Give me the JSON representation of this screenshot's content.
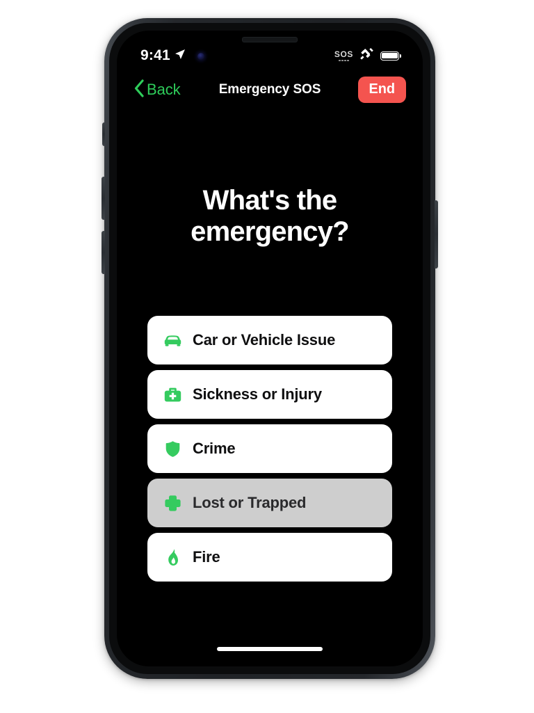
{
  "device": {
    "name": "iphone-mockup",
    "notch": "notch",
    "speaker": "earpiece-speaker",
    "camera": "front-camera"
  },
  "status_bar": {
    "time": "9:41",
    "location_icon": "location-arrow-icon",
    "sos_label": "SOS",
    "satellite_icon": "satellite-icon",
    "battery_icon": "battery-icon",
    "battery_level_percent": 100
  },
  "nav_bar": {
    "back_label": "Back",
    "back_icon": "chevron-left-icon",
    "title": "Emergency SOS",
    "end_label": "End"
  },
  "headline": "What's the emergency?",
  "options": [
    {
      "label": "Car or Vehicle Issue",
      "icon": "car-icon",
      "selected": false
    },
    {
      "label": "Sickness or Injury",
      "icon": "medical-bag-icon",
      "selected": false
    },
    {
      "label": "Crime",
      "icon": "shield-icon",
      "selected": false
    },
    {
      "label": "Lost or Trapped",
      "icon": "cross-plus-icon",
      "selected": true
    },
    {
      "label": "Fire",
      "icon": "flame-icon",
      "selected": false
    }
  ],
  "colors": {
    "accent_green": "#2ECC5A",
    "icon_green": "#35CB5F",
    "end_red": "#F4544F",
    "screen_background": "#000000",
    "card_background": "#FFFFFF",
    "card_selected_background": "#CECECE",
    "page_background": "#FFFFFF"
  },
  "home_indicator": "home-indicator"
}
